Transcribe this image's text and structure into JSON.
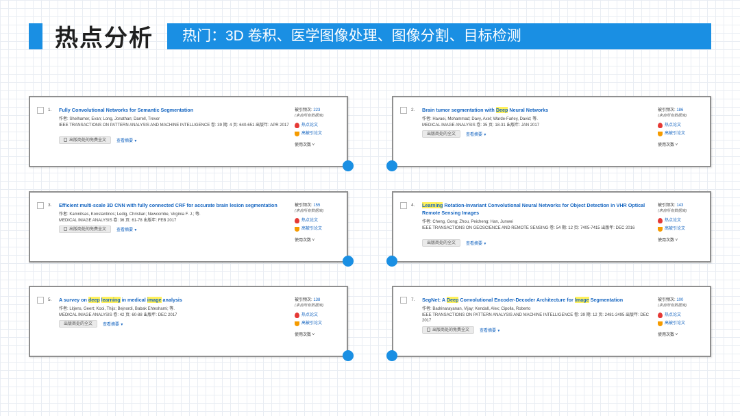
{
  "header": {
    "title": "热点分析",
    "subtitle": "热门：3D 卷积、医学图像处理、图像分割、目标检测"
  },
  "ui_labels": {
    "cites_label": "被引频次:",
    "cites_note": "(来自所有数据库)",
    "hot_paper": "热点论文",
    "highly_cited": "高被引论文",
    "usage": "使用次数",
    "free_fulltext": "出版商处的免费全文",
    "fulltext": "出版商处的全文",
    "view_abstract": "查看摘要"
  },
  "papers": [
    {
      "num": "1.",
      "title_parts": [
        {
          "t": "Fully Convolutional Networks for Semantic Segmentation",
          "h": false
        }
      ],
      "authors": "作者: Shelhamer, Evan; Long, Jonathan; Darrell, Trevor",
      "journal": "IEEE TRANSACTIONS ON PATTERN ANALYSIS AND MACHINE INTELLIGENCE  卷: 39  期: 4  页: 640-651  出版年: APR 2017",
      "citations": "223",
      "link": "出版商处的免费全文"
    },
    {
      "num": "2.",
      "title_parts": [
        {
          "t": "Brain tumor segmentation with ",
          "h": false
        },
        {
          "t": "Deep",
          "h": true
        },
        {
          "t": " Neural Networks",
          "h": false
        }
      ],
      "authors": "作者: Havaei, Mohammad; Davy, Axel; Warde-Farley, David; 等.",
      "journal": "MEDICAL IMAGE ANALYSIS  卷: 35  页: 18-31  出版年: JAN 2017",
      "citations": "186",
      "link": "出版商处的全文"
    },
    {
      "num": "3.",
      "title_parts": [
        {
          "t": "Efficient multi-scale 3D CNN with fully connected CRF for accurate brain lesion segmentation",
          "h": false
        }
      ],
      "authors": "作者: Kamnitsas, Konstantinos; Ledig, Christian; Newcombe, Virginia F. J.; 等.",
      "journal": "MEDICAL IMAGE ANALYSIS  卷: 36  页: 61-78  出版年: FEB 2017",
      "citations": "155",
      "link": "出版商处的免费全文"
    },
    {
      "num": "4.",
      "title_parts": [
        {
          "t": "Learning",
          "h": true
        },
        {
          "t": " Rotation-Invariant Convolutional Neural Networks for Object Detection in VHR Optical Remote Sensing Images",
          "h": false
        }
      ],
      "authors": "作者: Cheng, Gong; Zhou, Peicheng; Han, Junwei",
      "journal": "IEEE TRANSACTIONS ON GEOSCIENCE AND REMOTE SENSING  卷: 54  期: 12  页: 7405-7415  出版年: DEC 2016",
      "citations": "143",
      "link": "出版商处的全文"
    },
    {
      "num": "5.",
      "title_parts": [
        {
          "t": "A survey on ",
          "h": false
        },
        {
          "t": "deep",
          "h": true
        },
        {
          "t": " ",
          "h": false
        },
        {
          "t": "learning",
          "h": true
        },
        {
          "t": " in medical ",
          "h": false
        },
        {
          "t": "image",
          "h": true
        },
        {
          "t": " analysis",
          "h": false
        }
      ],
      "authors": "作者: Litjens, Geert; Kooi, Thijs; Bejnordi, Babak Ehteshami; 等.",
      "journal": "MEDICAL IMAGE ANALYSIS  卷: 42  页: 60-88  出版年: DEC 2017",
      "citations": "138",
      "link": "出版商处的全文"
    },
    {
      "num": "7.",
      "title_parts": [
        {
          "t": "SegNet: A ",
          "h": false
        },
        {
          "t": "Deep",
          "h": true
        },
        {
          "t": " Convolutional Encoder-Decoder Architecture for ",
          "h": false
        },
        {
          "t": "Image",
          "h": true
        },
        {
          "t": " Segmentation",
          "h": false
        }
      ],
      "authors": "作者: Badrinarayanan, Vijay; Kendall, Alex; Cipolla, Roberto",
      "journal": "IEEE TRANSACTIONS ON PATTERN ANALYSIS AND MACHINE INTELLIGENCE  卷: 39  期: 12  页: 2481-2495  出版年: DEC 2017",
      "citations": "100",
      "link": "出版商处的免费全文"
    }
  ],
  "colors": {
    "accent": "#1a8fe3",
    "link": "#1565c0",
    "highlight": "#fff15c"
  }
}
